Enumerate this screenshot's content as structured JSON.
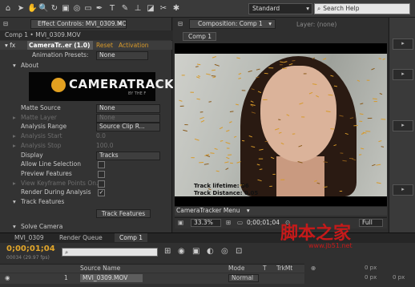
{
  "toolbar": {
    "workspace": "Standard",
    "search_placeholder": "Search Help",
    "tools": [
      "selection",
      "hand",
      "zoom",
      "rotate",
      "camera",
      "pan-behind",
      "rectangle",
      "pen",
      "type",
      "brush",
      "clone",
      "eraser",
      "roto",
      "puppet"
    ]
  },
  "effect_controls": {
    "tab_title": "Effect Controls: MVI_0309.MOV",
    "subheader": "Comp 1 • MVI_0309.MOV",
    "effect_name": "CameraTr..er (1.0)",
    "reset": "Reset",
    "activation": "Activation",
    "animation_presets_label": "Animation Presets:",
    "animation_presets_value": "None",
    "about": "About",
    "logo_text": "CAMERATRACK",
    "logo_sub": "BY THE F",
    "props": [
      {
        "label": "Matte Source",
        "value": "None",
        "kind": "dropdown",
        "dim": false
      },
      {
        "label": "Matte Layer",
        "value": "None",
        "kind": "dropdown",
        "dim": true
      },
      {
        "label": "Analysis Range",
        "value": "Source Clip R...",
        "kind": "dropdown",
        "dim": false
      },
      {
        "label": "Analysis Start",
        "value": "0.0",
        "kind": "text",
        "dim": true
      },
      {
        "label": "Analysis Stop",
        "value": "100.0",
        "kind": "text",
        "dim": true
      },
      {
        "label": "Display",
        "value": "Tracks",
        "kind": "dropdown",
        "dim": false
      },
      {
        "label": "Allow Line Selection",
        "value": "",
        "kind": "check",
        "dim": false
      },
      {
        "label": "Preview Features",
        "value": "",
        "kind": "check",
        "dim": false
      },
      {
        "label": "View Keyframe Points On...",
        "value": "",
        "kind": "check",
        "dim": true
      },
      {
        "label": "Render During Analysis",
        "value": "✓",
        "kind": "check",
        "dim": false
      }
    ],
    "track_features_group": "Track Features",
    "track_features_button": "Track Features",
    "solve_camera_group": "Solve Camera"
  },
  "composition": {
    "tab_title": "Composition: Comp 1",
    "layer_tab": "Layer: (none)",
    "comp_button": "Comp 1",
    "stat_line1": "Track lifetime: 56",
    "stat_line2": "Track Distance: 0.05",
    "overlay_menu": "CameraTracker Menu",
    "zoom": "33.3%",
    "current_time": "0;00;01;04",
    "full_label": "Full"
  },
  "right_panel": {
    "items": [
      "▸",
      "▸",
      "▸",
      "▸"
    ]
  },
  "timeline": {
    "tabs": [
      "MVI_0309",
      "Render Queue",
      "Comp 1"
    ],
    "timecode": "0;00;01;04",
    "fps": "00034 (29.97 fps)",
    "search_placeholder": "",
    "headers": {
      "source_name": "Source Name",
      "mode": "Mode",
      "t": "T",
      "trkmat": "TrkMt"
    },
    "layer": {
      "index": "1",
      "name": "MVI_0309.MOV",
      "mode": "Normal"
    },
    "px_values": [
      "0 px",
      "0 px",
      "0 px"
    ]
  },
  "watermark": {
    "cn": "脚本之家",
    "url": "www.jb51.net"
  },
  "colors": {
    "timecode": "#e3a72a",
    "logo_mark": "#e2a020",
    "watermark": "#c51a1a"
  }
}
